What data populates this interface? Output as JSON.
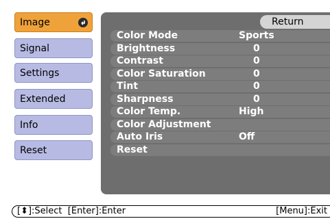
{
  "sidebar": {
    "items": [
      {
        "label": "Image",
        "active": true
      },
      {
        "label": "Signal",
        "active": false
      },
      {
        "label": "Settings",
        "active": false
      },
      {
        "label": "Extended",
        "active": false
      },
      {
        "label": "Info",
        "active": false
      },
      {
        "label": "Reset",
        "active": false
      }
    ]
  },
  "panel": {
    "return_label": "Return",
    "rows": [
      {
        "label": "Color Mode",
        "value": "Sports"
      },
      {
        "label": "Brightness",
        "value": "0"
      },
      {
        "label": "Contrast",
        "value": "0"
      },
      {
        "label": "Color Saturation",
        "value": "0"
      },
      {
        "label": "Tint",
        "value": "0"
      },
      {
        "label": "Sharpness",
        "value": "0"
      },
      {
        "label": "Color Temp.",
        "value": "High"
      },
      {
        "label": "Color Adjustment",
        "value": ""
      },
      {
        "label": "Auto Iris",
        "value": "Off"
      },
      {
        "label": "Reset",
        "value": ""
      }
    ]
  },
  "help": {
    "left": "[⬍]:Select  [Enter]:Enter",
    "right": "[Menu]:Exit"
  },
  "colors": {
    "active_tab": "#f0a23a",
    "tab": "#b7bbe3",
    "panel": "#6e6e6e",
    "row": "#7d7d7d"
  }
}
